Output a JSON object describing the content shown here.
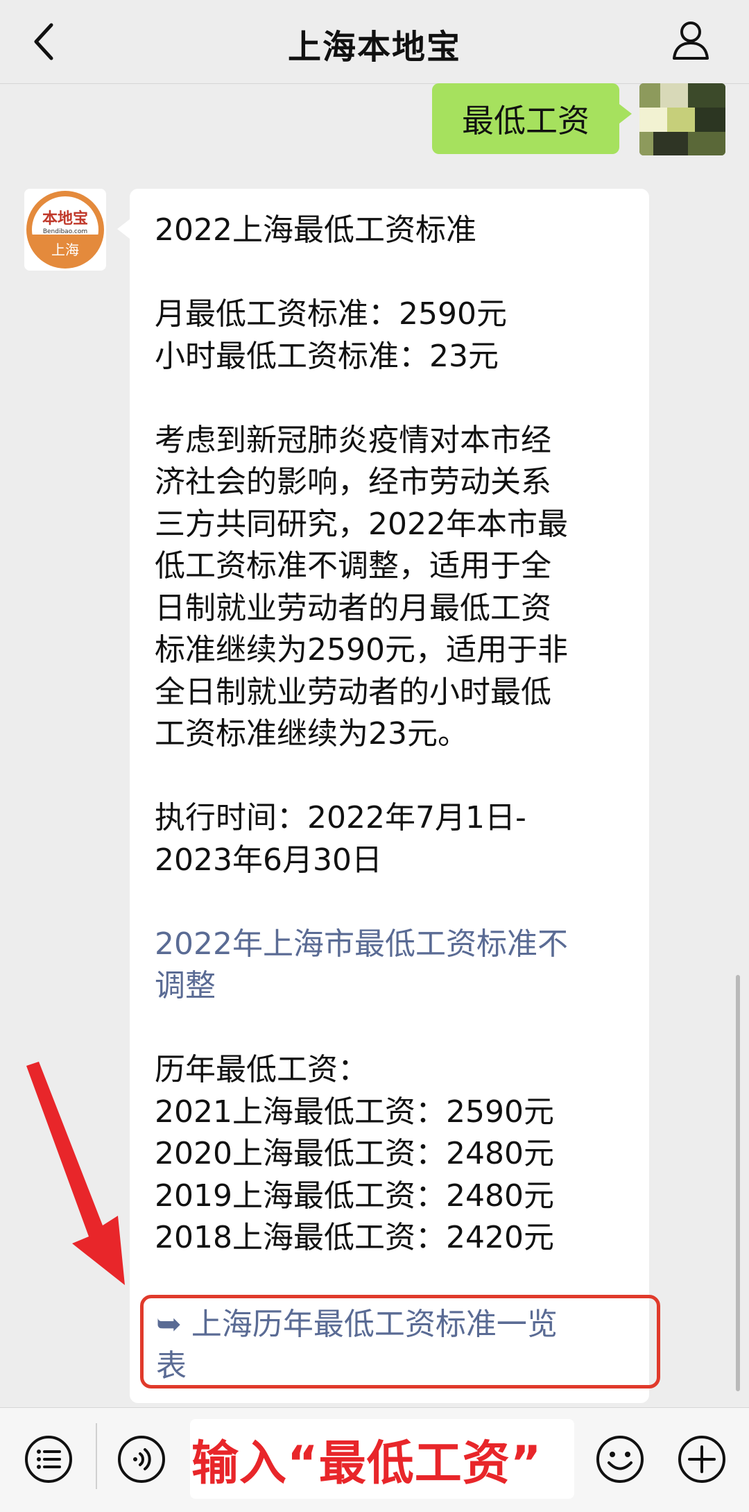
{
  "header": {
    "title": "上海本地宝"
  },
  "messages": {
    "user_text": "最低工资",
    "bot": {
      "avatar_logo": "本地宝",
      "avatar_sub": "Bendibao.com",
      "avatar_city": "上海",
      "lines": [
        "2022上海最低工资标准",
        "",
        "月最低工资标准：2590元",
        "小时最低工资标准：23元",
        "",
        "考虑到新冠肺炎疫情对本市经",
        "济社会的影响，经市劳动关系",
        "三方共同研究，2022年本市最",
        "低工资标准不调整，适用于全",
        "日制就业劳动者的月最低工资",
        "标准继续为2590元，适用于非",
        "全日制就业劳动者的小时最低",
        "工资标准继续为23元。",
        "",
        "执行时间：2022年7月1日-",
        "2023年6月30日",
        ""
      ],
      "link1_lines": [
        "2022年上海市最低工资标准不",
        "调整"
      ],
      "history_lines": [
        "",
        "历年最低工资：",
        "2021上海最低工资：2590元",
        "2020上海最低工资：2480元",
        "2019上海最低工资：2480元",
        "2018上海最低工资：2420元"
      ],
      "link2_lines": [
        "➥ 上海历年最低工资标准一览",
        "表"
      ]
    }
  },
  "input": {
    "annotation_text": "输入“最低工资”"
  },
  "icons": [
    "back-icon",
    "person-icon",
    "list-menu-icon",
    "voice-icon",
    "emoji-icon",
    "plus-icon"
  ],
  "colors": {
    "user_bubble": "#a6e15e",
    "link": "#5a6b94",
    "annotation_red": "#e8262a"
  }
}
